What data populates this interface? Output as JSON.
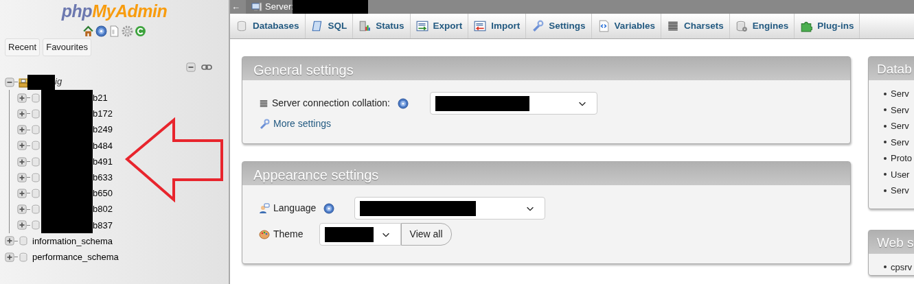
{
  "sidebar": {
    "logo": {
      "part_1": "php",
      "part_2": "MyAdmin"
    },
    "buttons": [
      "Recent",
      "Favourites"
    ],
    "tree": [
      {
        "label": "ig",
        "expanded": true,
        "children": [
          {
            "label": "b21",
            "expanded": false
          },
          {
            "label": "b172",
            "expanded": false
          },
          {
            "label": "b249",
            "expanded": false
          },
          {
            "label": "b484",
            "expanded": false
          },
          {
            "label": "b491",
            "expanded": false
          },
          {
            "label": "b633",
            "expanded": false
          },
          {
            "label": "b650",
            "expanded": false
          },
          {
            "label": "b802",
            "expanded": false
          },
          {
            "label": "b837",
            "expanded": false
          }
        ]
      },
      {
        "label": "information_schema",
        "expanded": false
      },
      {
        "label": "performance_schema",
        "expanded": false
      }
    ]
  },
  "breadcrumb": {
    "back": "←",
    "label": "Server:"
  },
  "tabs": [
    {
      "label": "Databases",
      "selected": false
    },
    {
      "label": "SQL",
      "selected": false
    },
    {
      "label": "Status",
      "selected": false
    },
    {
      "label": "Export",
      "selected": false
    },
    {
      "label": "Import",
      "selected": false
    },
    {
      "label": "Settings",
      "selected": false
    },
    {
      "label": "Variables",
      "selected": false
    },
    {
      "label": "Charsets",
      "selected": false
    },
    {
      "label": "Engines",
      "selected": false
    },
    {
      "label": "Plug-ins",
      "selected": false
    }
  ],
  "general_settings": {
    "title": "General settings",
    "collation_label": "Server connection collation:",
    "more_settings": "More settings"
  },
  "appearance_settings": {
    "title": "Appearance settings",
    "language_label": "Language",
    "theme_label": "Theme",
    "view_all": "View all"
  },
  "side_panels": [
    {
      "title": "Datab",
      "items": [
        "Serv",
        "Serv",
        "Serv",
        "Serv",
        "Proto",
        "User",
        "Serv"
      ]
    },
    {
      "title": "Web s",
      "items": [
        "cpsrv"
      ]
    }
  ]
}
